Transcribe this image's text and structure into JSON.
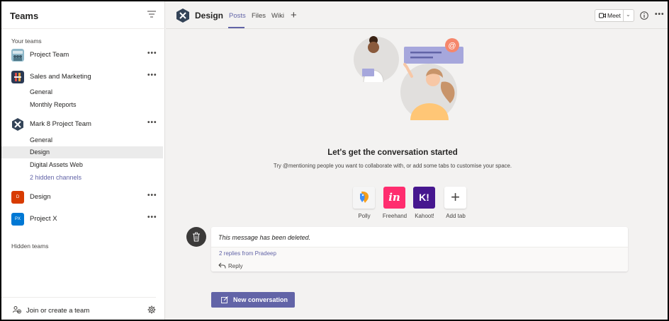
{
  "sidebar": {
    "title": "Teams",
    "your_teams_label": "Your teams",
    "hidden_teams_label": "Hidden teams",
    "teams": [
      {
        "name": "Project Team",
        "more": "•••"
      },
      {
        "name": "Sales and Marketing",
        "more": "•••",
        "channels": [
          "General",
          "Monthly Reports"
        ]
      },
      {
        "name": "Mark 8 Project Team",
        "more": "•••",
        "channels": [
          "General",
          "Design",
          "Digital Assets Web",
          "2 hidden channels"
        ]
      },
      {
        "name": "Design",
        "more": "•••",
        "avatar_text": "D"
      },
      {
        "name": "Project X",
        "more": "•••",
        "avatar_text": "PX"
      }
    ],
    "join_label": "Join or create a team"
  },
  "header": {
    "channel_title": "Design",
    "tabs": [
      "Posts",
      "Files",
      "Wiki"
    ],
    "add_tab_glyph": "+",
    "meet_label": "Meet",
    "meet_chevron": "⌄",
    "more": "•••"
  },
  "main": {
    "heading": "Let's get the conversation started",
    "subheading": "Try @mentioning people you want to collaborate with, or add some tabs to customise your space.",
    "apps": [
      {
        "label": "Polly",
        "glyph": ""
      },
      {
        "label": "Freehand",
        "glyph": "in"
      },
      {
        "label": "Kahoot!",
        "glyph": "K!"
      },
      {
        "label": "Add tab",
        "glyph": "+"
      }
    ],
    "message": {
      "text": "This message has been deleted.",
      "replies": "2 replies from Pradeep",
      "reply_label": "Reply"
    },
    "new_conversation_label": "New conversation"
  },
  "colors": {
    "accent": "#6264a7",
    "background": "#f3f2f1",
    "design_avatar": "#d83b01",
    "projectx_avatar": "#0078d4",
    "freehand": "#ff2d6f",
    "kahoot": "#46178f"
  }
}
